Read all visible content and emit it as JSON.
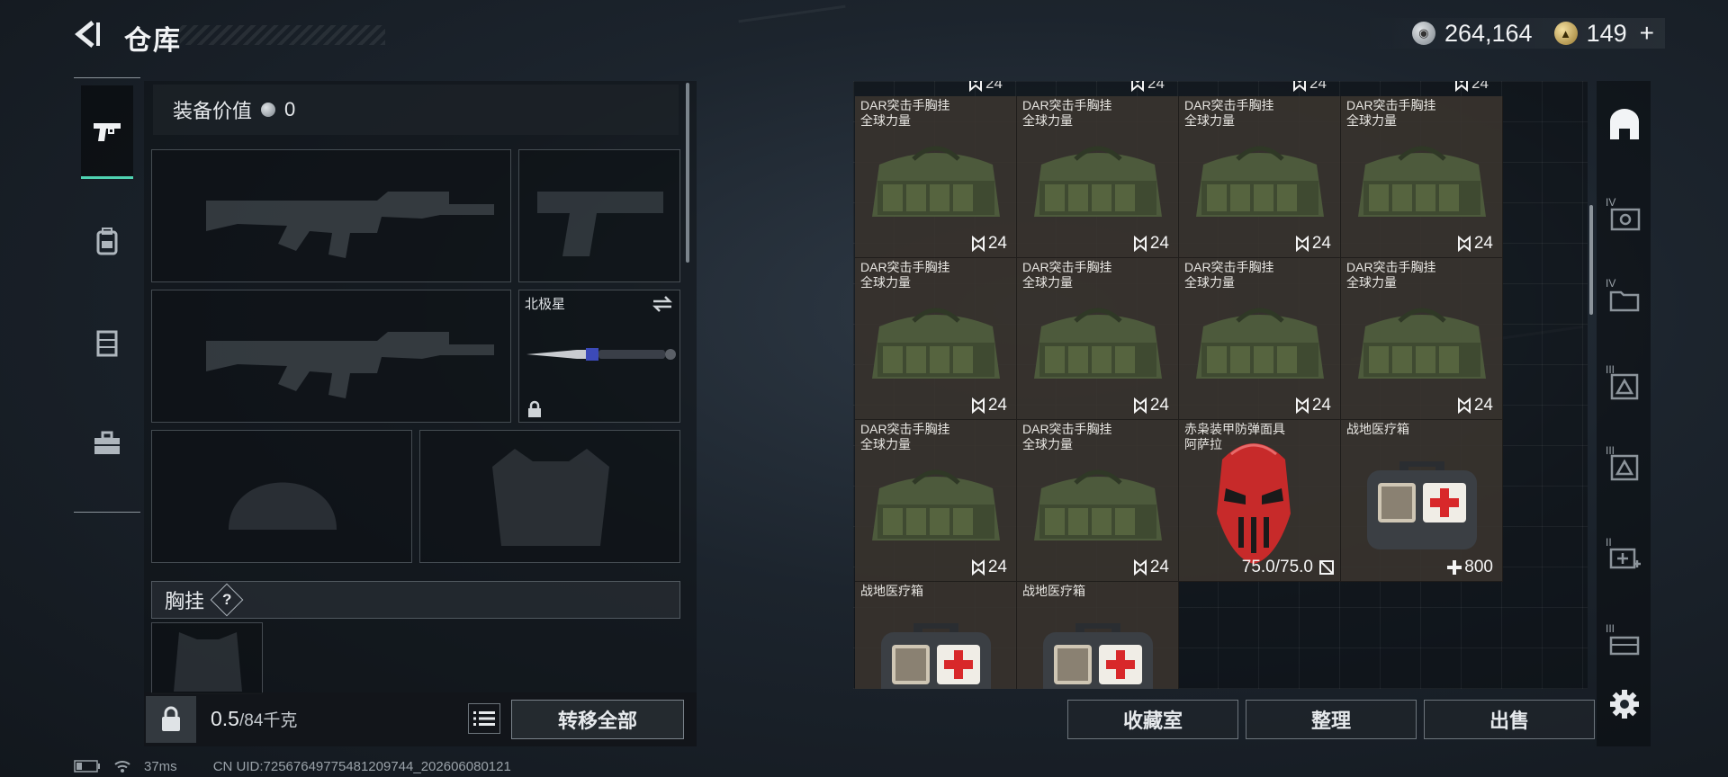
{
  "header": {
    "title": "仓库",
    "currency_silver": "264,164",
    "currency_gold": "149",
    "plus": "+"
  },
  "left_tabs": [
    "weapon-tab-icon",
    "backpack-tab-icon",
    "armor-tab-icon",
    "toolbox-tab-icon"
  ],
  "loadout": {
    "equip_value_label": "装备价值",
    "equip_value": "0",
    "melee_name": "北极星",
    "section_label": "胸挂",
    "help": "?"
  },
  "weight": {
    "current": "0.5",
    "max": "/84千克",
    "transfer_all": "转移全部"
  },
  "status": {
    "ping": "37ms",
    "uid": "CN UID:7256764977548120​9744_202606080121"
  },
  "stash": {
    "top_counts": [
      "24",
      "24",
      "24",
      "24"
    ],
    "items": [
      {
        "name1": "DAR突击手胸挂",
        "name2": "全球力量",
        "count": "24",
        "kind": "bag"
      },
      {
        "name1": "DAR突击手胸挂",
        "name2": "全球力量",
        "count": "24",
        "kind": "bag"
      },
      {
        "name1": "DAR突击手胸挂",
        "name2": "全球力量",
        "count": "24",
        "kind": "bag"
      },
      {
        "name1": "DAR突击手胸挂",
        "name2": "全球力量",
        "count": "24",
        "kind": "bag"
      },
      {
        "name1": "DAR突击手胸挂",
        "name2": "全球力量",
        "count": "24",
        "kind": "bag"
      },
      {
        "name1": "DAR突击手胸挂",
        "name2": "全球力量",
        "count": "24",
        "kind": "bag"
      },
      {
        "name1": "DAR突击手胸挂",
        "name2": "全球力量",
        "count": "24",
        "kind": "bag"
      },
      {
        "name1": "DAR突击手胸挂",
        "name2": "全球力量",
        "count": "24",
        "kind": "bag"
      },
      {
        "name1": "DAR突击手胸挂",
        "name2": "全球力量",
        "count": "24",
        "kind": "bag"
      },
      {
        "name1": "DAR突击手胸挂",
        "name2": "全球力量",
        "count": "24",
        "kind": "bag"
      },
      {
        "name1": "赤枭装甲防弹面具",
        "name2": "阿萨拉",
        "durability": "75.0/75.0",
        "kind": "mask"
      },
      {
        "name1": "战地医疗箱",
        "name2": "",
        "heal": "800",
        "kind": "medkit"
      },
      {
        "name1": "战地医疗箱",
        "name2": "",
        "kind": "medkit"
      },
      {
        "name1": "战地医疗箱",
        "name2": "",
        "kind": "medkit"
      }
    ],
    "buttons": {
      "collection": "收藏室",
      "sort": "整理",
      "sell": "出售"
    }
  },
  "right_rail": {
    "labels": [
      "IV",
      "IV",
      "III",
      "III",
      "II",
      "III"
    ]
  },
  "colors": {
    "accent": "#4fd2b1",
    "item_bg": "#3a342f",
    "medkit_red": "#d8282a",
    "mask_red": "#c72a2a"
  }
}
